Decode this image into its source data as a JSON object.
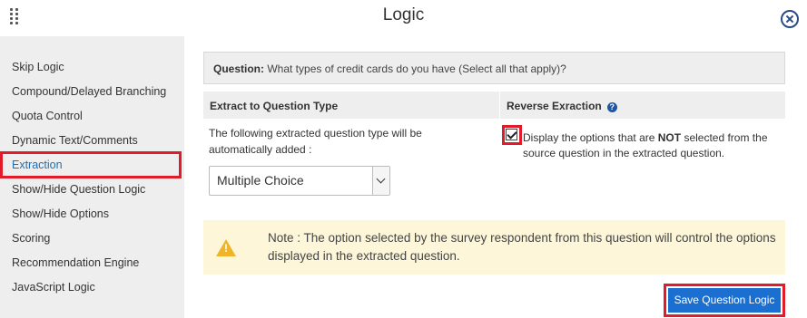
{
  "header": {
    "title": "Logic"
  },
  "sidebar": {
    "items": [
      {
        "label": "Skip Logic"
      },
      {
        "label": "Compound/Delayed Branching"
      },
      {
        "label": "Quota Control"
      },
      {
        "label": "Dynamic Text/Comments"
      },
      {
        "label": "Extraction",
        "active": true
      },
      {
        "label": "Show/Hide Question Logic"
      },
      {
        "label": "Show/Hide Options"
      },
      {
        "label": "Scoring"
      },
      {
        "label": "Recommendation Engine"
      },
      {
        "label": "JavaScript Logic"
      }
    ]
  },
  "question": {
    "label": "Question:",
    "text": "What types of credit cards do you have (Select all that apply)?"
  },
  "table": {
    "col1_header": "Extract to Question Type",
    "col2_header": "Reverse Exraction",
    "col1_description": "The following extracted question type will be automatically added :",
    "select_value": "Multiple Choice",
    "reverse_checked": true,
    "reverse_text_before": "Display the options that are ",
    "reverse_text_bold": "NOT",
    "reverse_text_after": " selected from the source question in the extracted question."
  },
  "note": {
    "text": "Note : The option selected by the survey respondent from this question will control the options displayed in the extracted question."
  },
  "footer": {
    "save_label": "Save Question Logic"
  },
  "icons": {
    "drag": "drag-handle-icon",
    "close": "close-icon",
    "help": "help-icon",
    "warning": "warning-icon",
    "dropdown": "chevron-down-icon"
  },
  "colors": {
    "accent": "#1b6fd1",
    "highlight": "#e21b2a",
    "note_bg": "#fdf6d8",
    "warning": "#f0b429"
  }
}
